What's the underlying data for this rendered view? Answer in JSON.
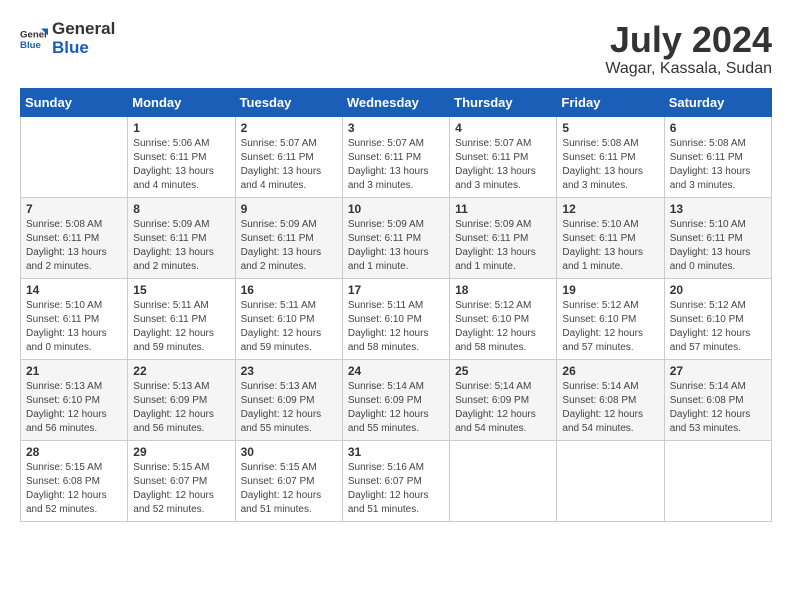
{
  "header": {
    "logo_general": "General",
    "logo_blue": "Blue",
    "month_year": "July 2024",
    "location": "Wagar, Kassala, Sudan"
  },
  "weekdays": [
    "Sunday",
    "Monday",
    "Tuesday",
    "Wednesday",
    "Thursday",
    "Friday",
    "Saturday"
  ],
  "weeks": [
    [
      {
        "day": "",
        "sunrise": "",
        "sunset": "",
        "daylight": ""
      },
      {
        "day": "1",
        "sunrise": "Sunrise: 5:06 AM",
        "sunset": "Sunset: 6:11 PM",
        "daylight": "Daylight: 13 hours and 4 minutes."
      },
      {
        "day": "2",
        "sunrise": "Sunrise: 5:07 AM",
        "sunset": "Sunset: 6:11 PM",
        "daylight": "Daylight: 13 hours and 4 minutes."
      },
      {
        "day": "3",
        "sunrise": "Sunrise: 5:07 AM",
        "sunset": "Sunset: 6:11 PM",
        "daylight": "Daylight: 13 hours and 3 minutes."
      },
      {
        "day": "4",
        "sunrise": "Sunrise: 5:07 AM",
        "sunset": "Sunset: 6:11 PM",
        "daylight": "Daylight: 13 hours and 3 minutes."
      },
      {
        "day": "5",
        "sunrise": "Sunrise: 5:08 AM",
        "sunset": "Sunset: 6:11 PM",
        "daylight": "Daylight: 13 hours and 3 minutes."
      },
      {
        "day": "6",
        "sunrise": "Sunrise: 5:08 AM",
        "sunset": "Sunset: 6:11 PM",
        "daylight": "Daylight: 13 hours and 3 minutes."
      }
    ],
    [
      {
        "day": "7",
        "sunrise": "Sunrise: 5:08 AM",
        "sunset": "Sunset: 6:11 PM",
        "daylight": "Daylight: 13 hours and 2 minutes."
      },
      {
        "day": "8",
        "sunrise": "Sunrise: 5:09 AM",
        "sunset": "Sunset: 6:11 PM",
        "daylight": "Daylight: 13 hours and 2 minutes."
      },
      {
        "day": "9",
        "sunrise": "Sunrise: 5:09 AM",
        "sunset": "Sunset: 6:11 PM",
        "daylight": "Daylight: 13 hours and 2 minutes."
      },
      {
        "day": "10",
        "sunrise": "Sunrise: 5:09 AM",
        "sunset": "Sunset: 6:11 PM",
        "daylight": "Daylight: 13 hours and 1 minute."
      },
      {
        "day": "11",
        "sunrise": "Sunrise: 5:09 AM",
        "sunset": "Sunset: 6:11 PM",
        "daylight": "Daylight: 13 hours and 1 minute."
      },
      {
        "day": "12",
        "sunrise": "Sunrise: 5:10 AM",
        "sunset": "Sunset: 6:11 PM",
        "daylight": "Daylight: 13 hours and 1 minute."
      },
      {
        "day": "13",
        "sunrise": "Sunrise: 5:10 AM",
        "sunset": "Sunset: 6:11 PM",
        "daylight": "Daylight: 13 hours and 0 minutes."
      }
    ],
    [
      {
        "day": "14",
        "sunrise": "Sunrise: 5:10 AM",
        "sunset": "Sunset: 6:11 PM",
        "daylight": "Daylight: 13 hours and 0 minutes."
      },
      {
        "day": "15",
        "sunrise": "Sunrise: 5:11 AM",
        "sunset": "Sunset: 6:11 PM",
        "daylight": "Daylight: 12 hours and 59 minutes."
      },
      {
        "day": "16",
        "sunrise": "Sunrise: 5:11 AM",
        "sunset": "Sunset: 6:10 PM",
        "daylight": "Daylight: 12 hours and 59 minutes."
      },
      {
        "day": "17",
        "sunrise": "Sunrise: 5:11 AM",
        "sunset": "Sunset: 6:10 PM",
        "daylight": "Daylight: 12 hours and 58 minutes."
      },
      {
        "day": "18",
        "sunrise": "Sunrise: 5:12 AM",
        "sunset": "Sunset: 6:10 PM",
        "daylight": "Daylight: 12 hours and 58 minutes."
      },
      {
        "day": "19",
        "sunrise": "Sunrise: 5:12 AM",
        "sunset": "Sunset: 6:10 PM",
        "daylight": "Daylight: 12 hours and 57 minutes."
      },
      {
        "day": "20",
        "sunrise": "Sunrise: 5:12 AM",
        "sunset": "Sunset: 6:10 PM",
        "daylight": "Daylight: 12 hours and 57 minutes."
      }
    ],
    [
      {
        "day": "21",
        "sunrise": "Sunrise: 5:13 AM",
        "sunset": "Sunset: 6:10 PM",
        "daylight": "Daylight: 12 hours and 56 minutes."
      },
      {
        "day": "22",
        "sunrise": "Sunrise: 5:13 AM",
        "sunset": "Sunset: 6:09 PM",
        "daylight": "Daylight: 12 hours and 56 minutes."
      },
      {
        "day": "23",
        "sunrise": "Sunrise: 5:13 AM",
        "sunset": "Sunset: 6:09 PM",
        "daylight": "Daylight: 12 hours and 55 minutes."
      },
      {
        "day": "24",
        "sunrise": "Sunrise: 5:14 AM",
        "sunset": "Sunset: 6:09 PM",
        "daylight": "Daylight: 12 hours and 55 minutes."
      },
      {
        "day": "25",
        "sunrise": "Sunrise: 5:14 AM",
        "sunset": "Sunset: 6:09 PM",
        "daylight": "Daylight: 12 hours and 54 minutes."
      },
      {
        "day": "26",
        "sunrise": "Sunrise: 5:14 AM",
        "sunset": "Sunset: 6:08 PM",
        "daylight": "Daylight: 12 hours and 54 minutes."
      },
      {
        "day": "27",
        "sunrise": "Sunrise: 5:14 AM",
        "sunset": "Sunset: 6:08 PM",
        "daylight": "Daylight: 12 hours and 53 minutes."
      }
    ],
    [
      {
        "day": "28",
        "sunrise": "Sunrise: 5:15 AM",
        "sunset": "Sunset: 6:08 PM",
        "daylight": "Daylight: 12 hours and 52 minutes."
      },
      {
        "day": "29",
        "sunrise": "Sunrise: 5:15 AM",
        "sunset": "Sunset: 6:07 PM",
        "daylight": "Daylight: 12 hours and 52 minutes."
      },
      {
        "day": "30",
        "sunrise": "Sunrise: 5:15 AM",
        "sunset": "Sunset: 6:07 PM",
        "daylight": "Daylight: 12 hours and 51 minutes."
      },
      {
        "day": "31",
        "sunrise": "Sunrise: 5:16 AM",
        "sunset": "Sunset: 6:07 PM",
        "daylight": "Daylight: 12 hours and 51 minutes."
      },
      {
        "day": "",
        "sunrise": "",
        "sunset": "",
        "daylight": ""
      },
      {
        "day": "",
        "sunrise": "",
        "sunset": "",
        "daylight": ""
      },
      {
        "day": "",
        "sunrise": "",
        "sunset": "",
        "daylight": ""
      }
    ]
  ]
}
